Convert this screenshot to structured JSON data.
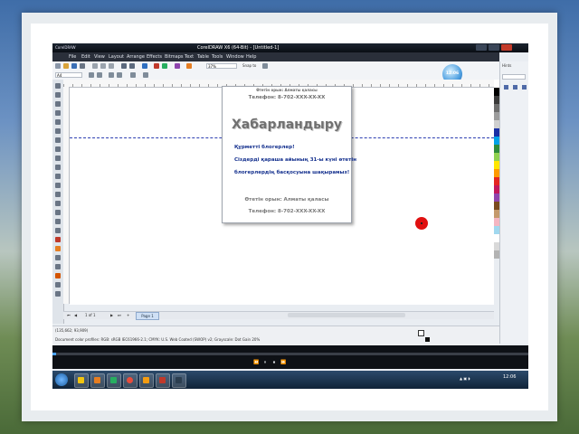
{
  "window": {
    "app_short": "CorelDRAW",
    "title": "CorelDRAW X6 (64-Bit) - [Untitled-1]"
  },
  "menu": [
    "File",
    "Edit",
    "View",
    "Layout",
    "Arrange",
    "Effects",
    "Bitmaps",
    "Text",
    "Table",
    "Tools",
    "Window",
    "Help"
  ],
  "toolbar": {
    "zoom_value": "37%",
    "snap_label": "Snap to"
  },
  "propbar": {
    "page_size": "A4"
  },
  "badge": "12:06",
  "page": {
    "top_line": "Өтетін орын: Алматы қаласы",
    "top_phone": "Телефон: 8-702-XXX-XX-XX",
    "heading": "Хабарландыру",
    "body_lines": [
      "Құрметті блогерлер!",
      "Сіздерді қараша айының 31-ы күні өтетін",
      "блогерлердің басқосуына шақырамыз!"
    ],
    "footer_org": "Өтетін орын: Алматы қаласы",
    "footer_phone": "Телефон: 8-702-XXX-XX-XX"
  },
  "pagenav": {
    "counter": "1 of 1",
    "tab": "Page 1"
  },
  "status": {
    "coords": "(135,662; 93,909)",
    "profiles": "Document color profiles: RGB: sRGB IEC61966-2.1; CMYK: U.S. Web Coated (SWOP) v2; Grayscale: Dot Gain 20%"
  },
  "rightpanel": {
    "title": "Hints"
  },
  "palette": [
    "#ffffff",
    "#000000",
    "#3a3a3a",
    "#6d6d6d",
    "#9c9c9c",
    "#cfcfcf",
    "#1a2fa5",
    "#00a2e8",
    "#2e8b3a",
    "#8fd14f",
    "#ffe600",
    "#ff9a00",
    "#e52521",
    "#c2185b",
    "#8e44ad",
    "#7a4a1e",
    "#c49a6c",
    "#f4b6c2",
    "#a0d8ef",
    "#ffffff",
    "#d9d9d9",
    "#b3b3b3"
  ],
  "taskbar": {
    "clock": "12:06"
  }
}
